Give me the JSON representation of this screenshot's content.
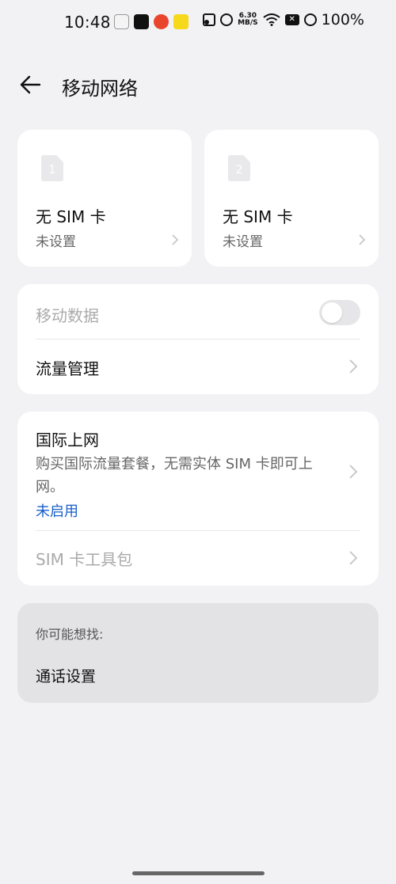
{
  "status_bar": {
    "time": "10:48",
    "net_speed_value": "6.30",
    "net_speed_unit": "MB/S",
    "battery_x": "✕",
    "battery_percent": "100%"
  },
  "header": {
    "title": "移动网络",
    "back_icon": "arrow-left-icon"
  },
  "sim_cards": [
    {
      "slot": "1",
      "name": "无 SIM 卡",
      "status": "未设置"
    },
    {
      "slot": "2",
      "name": "无 SIM 卡",
      "status": "未设置"
    }
  ],
  "data_section": {
    "mobile_data_label": "移动数据",
    "mobile_data_enabled": false,
    "traffic_label": "流量管理"
  },
  "intl_section": {
    "title": "国际上网",
    "description": "购买国际流量套餐，无需实体 SIM 卡即可上网。",
    "status": "未启用",
    "status_color": "#1a5fc8",
    "sim_toolkit_label": "SIM 卡工具包"
  },
  "suggestions": {
    "heading": "你可能想找:",
    "items": [
      "通话设置"
    ]
  }
}
